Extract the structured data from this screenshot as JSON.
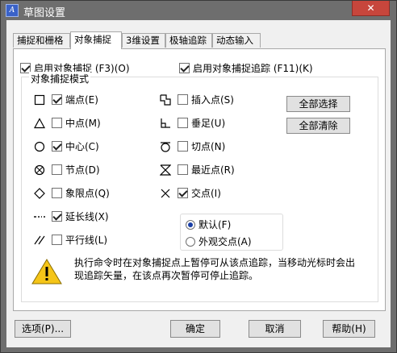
{
  "window": {
    "title": "草图设置",
    "app_icon_text": "A",
    "close_label": "✕"
  },
  "tabs": [
    {
      "label": "捕捉和栅格",
      "active": false
    },
    {
      "label": "对象捕捉",
      "active": true
    },
    {
      "label": "3维设置",
      "active": false
    },
    {
      "label": "极轴追踪",
      "active": false
    },
    {
      "label": "动态输入",
      "active": false
    }
  ],
  "top_options": {
    "enable_osnap": {
      "label": "启用对象捕捉 (F3)(O)",
      "checked": true
    },
    "enable_tracking": {
      "label": "启用对象捕捉追踪 (F11)(K)",
      "checked": true
    }
  },
  "osnap_modes": {
    "title": "对象捕捉模式",
    "left": [
      {
        "label": "端点(E)",
        "checked": true,
        "icon": "square"
      },
      {
        "label": "中点(M)",
        "checked": false,
        "icon": "triangle"
      },
      {
        "label": "中心(C)",
        "checked": true,
        "icon": "circle"
      },
      {
        "label": "节点(D)",
        "checked": false,
        "icon": "node"
      },
      {
        "label": "象限点(Q)",
        "checked": false,
        "icon": "diamond"
      },
      {
        "label": "延长线(X)",
        "checked": true,
        "icon": "extension"
      },
      {
        "label": "平行线(L)",
        "checked": false,
        "icon": "parallel"
      }
    ],
    "right": [
      {
        "label": "插入点(S)",
        "checked": false,
        "icon": "insertion"
      },
      {
        "label": "垂足(U)",
        "checked": false,
        "icon": "perpendicular"
      },
      {
        "label": "切点(N)",
        "checked": false,
        "icon": "tangent"
      },
      {
        "label": "最近点(R)",
        "checked": false,
        "icon": "nearest"
      },
      {
        "label": "交点(I)",
        "checked": true,
        "icon": "intersection"
      }
    ],
    "select_all": "全部选择",
    "clear_all": "全部清除",
    "intersection_mode": {
      "default_label": "默认(F)",
      "apparent_label": "外观交点(A)",
      "selected": "default"
    }
  },
  "note": "执行命令时在对象捕捉点上暂停可从该点追踪，当移动光标时会出现追踪矢量，在该点再次暂停可停止追踪。",
  "footer": {
    "options": "选项(P)...",
    "ok": "确定",
    "cancel": "取消",
    "help": "帮助(H)"
  }
}
